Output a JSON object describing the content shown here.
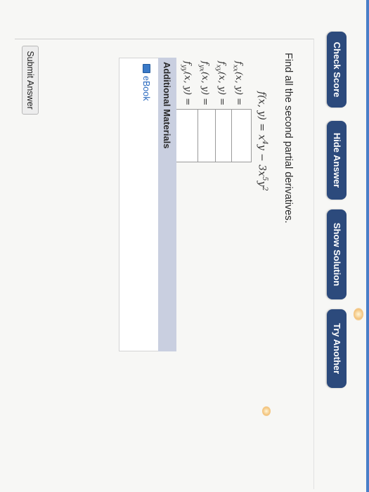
{
  "toolbar": {
    "check_score": "Check Score",
    "hide_answer": "Hide Answer",
    "show_solution": "Show Solution",
    "try_another": "Try Another"
  },
  "question": {
    "prompt": "Find all the second partial derivatives.",
    "function": {
      "lhs": "f(x, y) = x",
      "exp1": "4",
      "mid": "y − 3x",
      "exp2": "5",
      "y": "y",
      "exp3": "2"
    },
    "rows": [
      {
        "f": "f",
        "sub": "xx",
        "args": "(x, y) =",
        "value": ""
      },
      {
        "f": "f",
        "sub": "xy",
        "args": "(x, y) =",
        "value": ""
      },
      {
        "f": "f",
        "sub": "yx",
        "args": "(x, y) =",
        "value": ""
      },
      {
        "f": "f",
        "sub": "yy",
        "args": "(x, y) =",
        "value": ""
      }
    ]
  },
  "additional_materials": {
    "title": "Additional Materials",
    "links": [
      {
        "label": "eBook",
        "icon": "ebook-icon"
      }
    ]
  },
  "submit": {
    "label": "Submit Answer"
  },
  "colors": {
    "button_bg": "#2c4a7c",
    "accent": "#4a7fc8",
    "section_header": "#c9cfe0",
    "link": "#2a6abf"
  }
}
